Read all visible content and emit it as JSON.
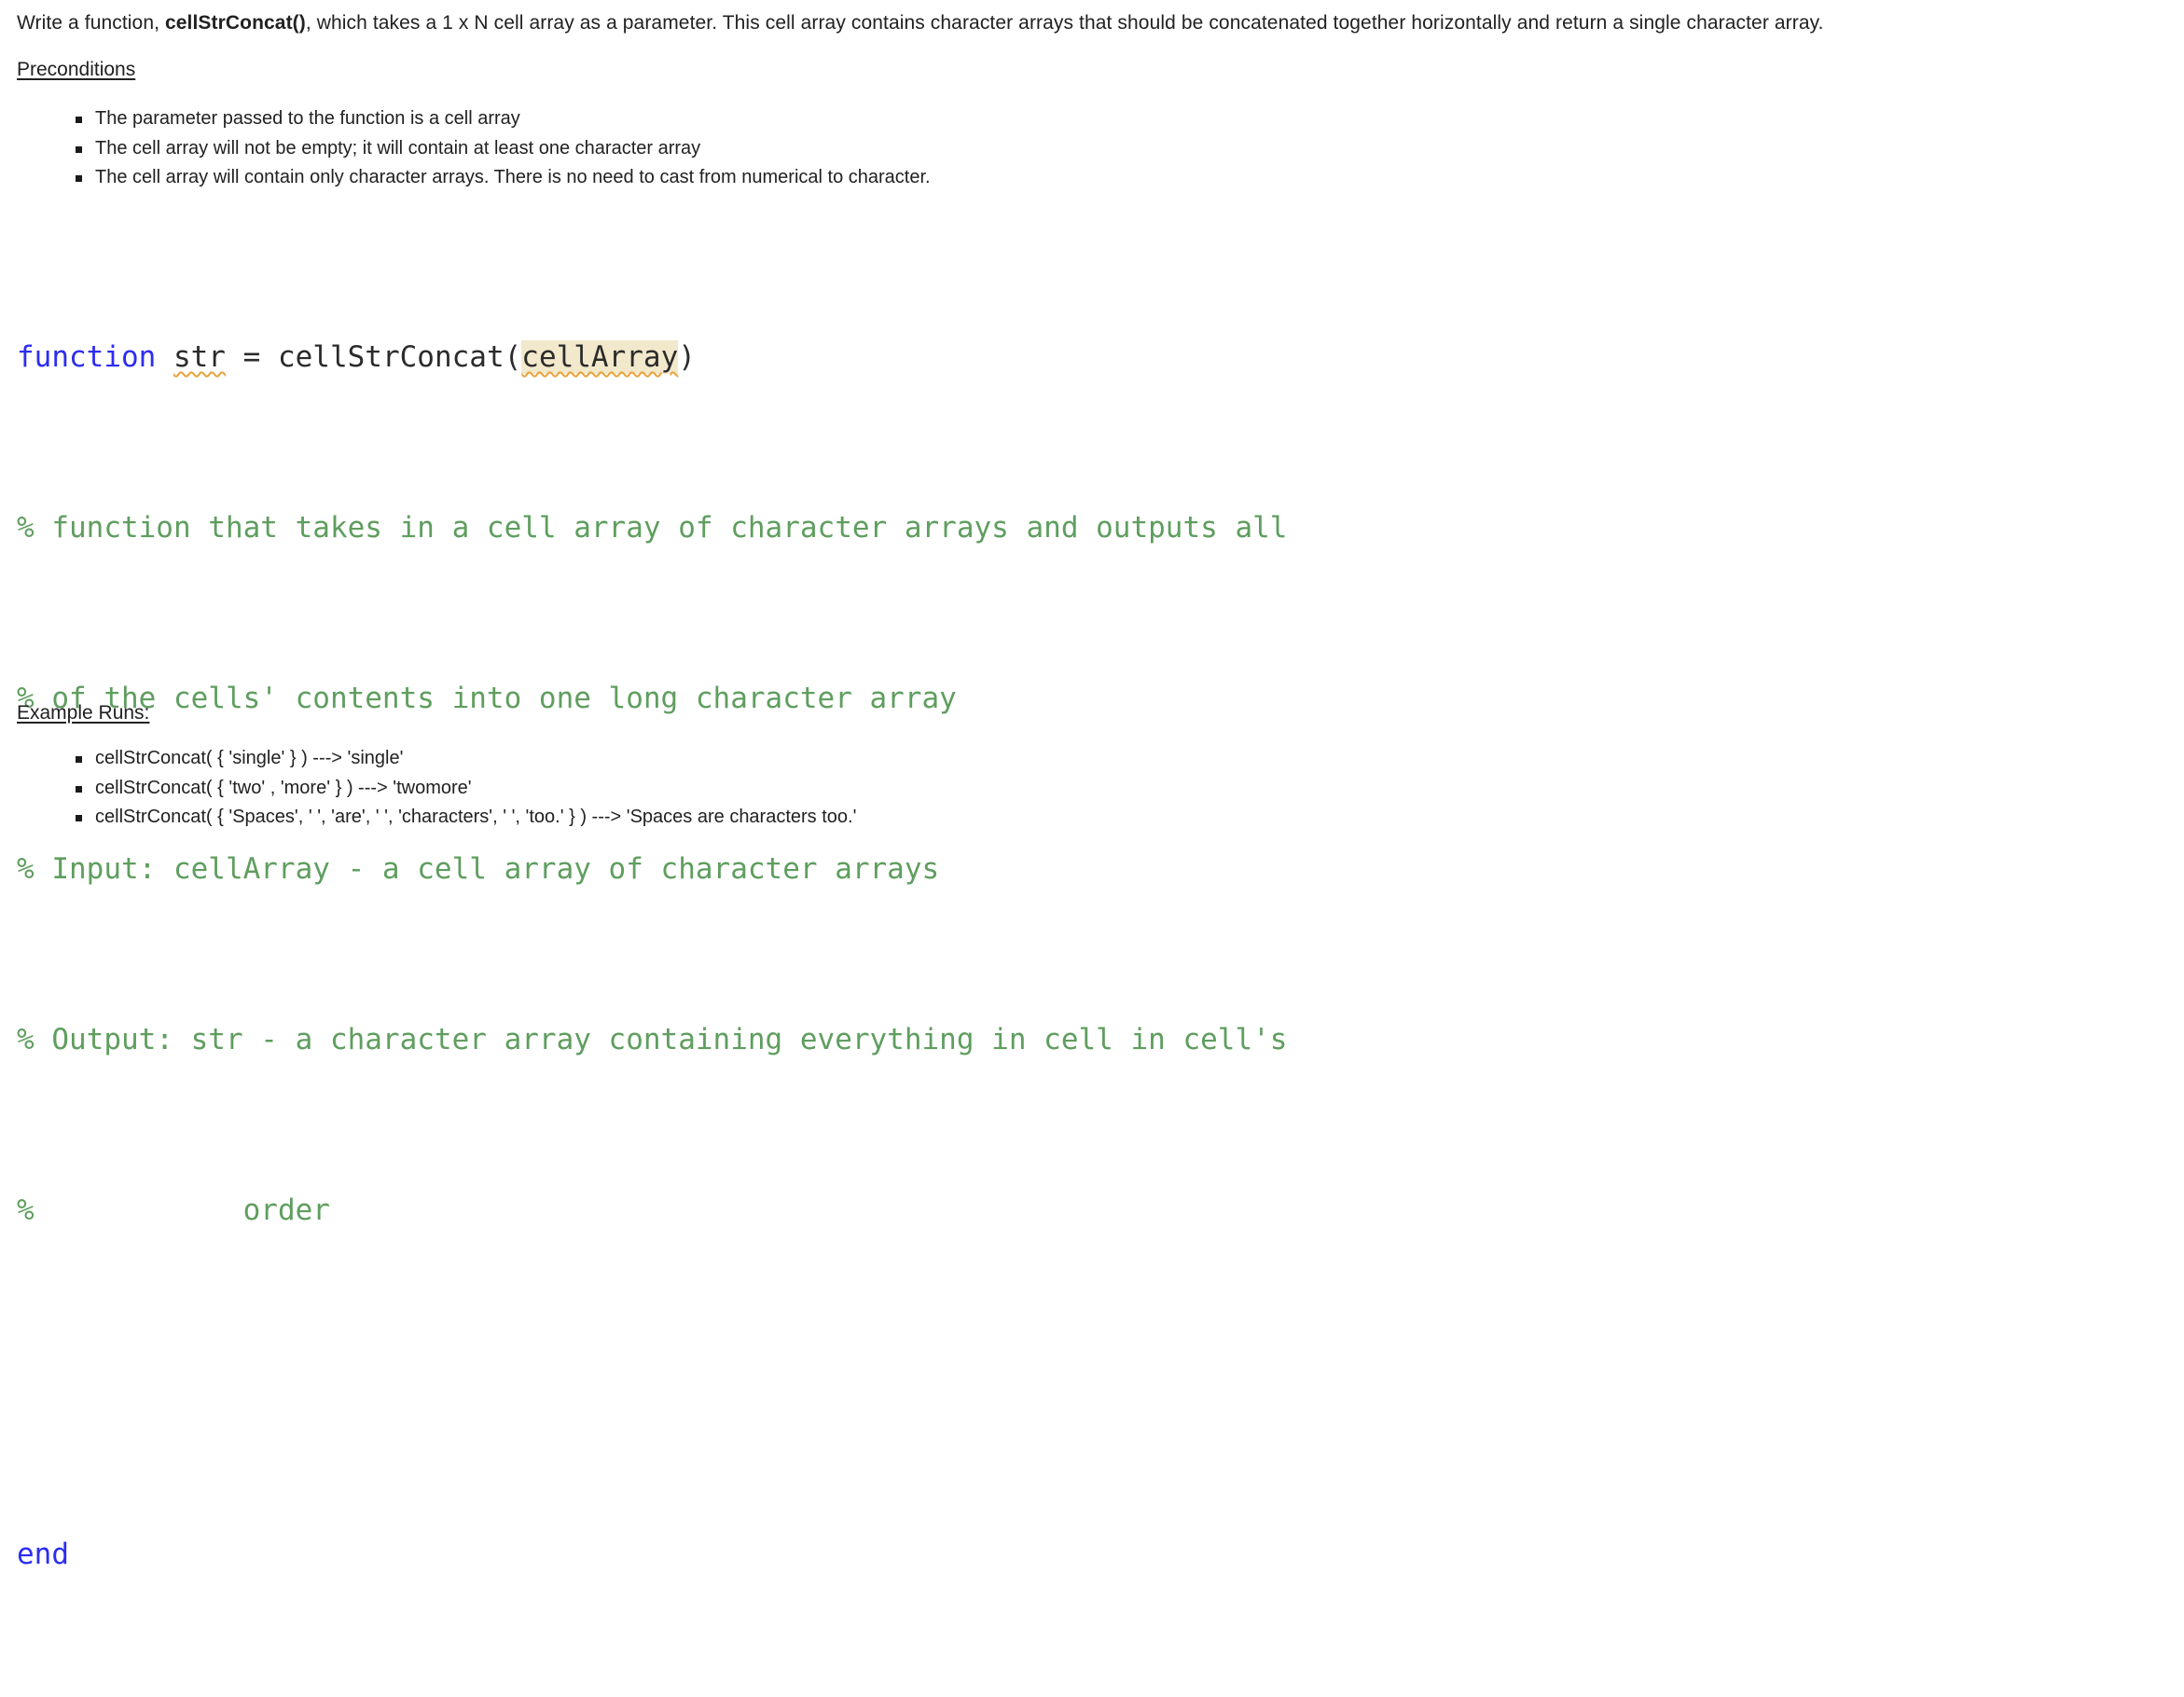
{
  "intro": {
    "before": "Write a function, ",
    "function_name": "cellStrConcat()",
    "after": ", which takes a 1 x N cell array as a parameter. This cell array contains character arrays that should be concatenated together horizontally and return a single character array."
  },
  "preconditions": {
    "heading": "Preconditions",
    "items": [
      "The parameter passed to the function is a cell array",
      "The cell array will not be empty; it will contain at least one character array",
      "The cell array will contain only character arrays. There is no need to cast from numerical to character."
    ]
  },
  "code": {
    "signature": {
      "keyword": "function",
      "output_var": "str",
      "equals": " = ",
      "func_name": "cellStrConcat(",
      "param": "cellArray",
      "close_paren": ")"
    },
    "comments": [
      "% function that takes in a cell array of character arrays and outputs all",
      "% of the cells' contents into one long character array",
      "% Input: cellArray - a cell array of character arrays",
      "% Output: str - a character array containing everything in cell in cell's",
      "%            order"
    ],
    "end_keyword": "end",
    "colors": {
      "keyword": "#2d2df0",
      "comment": "#5f9e5f",
      "plain": "#2b2b2b",
      "param_highlight": "#f2e8cb",
      "squiggle": "#e8a33d"
    }
  },
  "examples": {
    "heading": "Example Runs:",
    "items": [
      "cellStrConcat( { 'single' } ) ---> 'single'",
      "cellStrConcat( { 'two' , 'more' } ) ---> 'twomore'",
      "cellStrConcat( { 'Spaces', ' ', 'are', ' ', 'characters', ' ', 'too.' } ) ---> 'Spaces are characters too.'"
    ]
  }
}
